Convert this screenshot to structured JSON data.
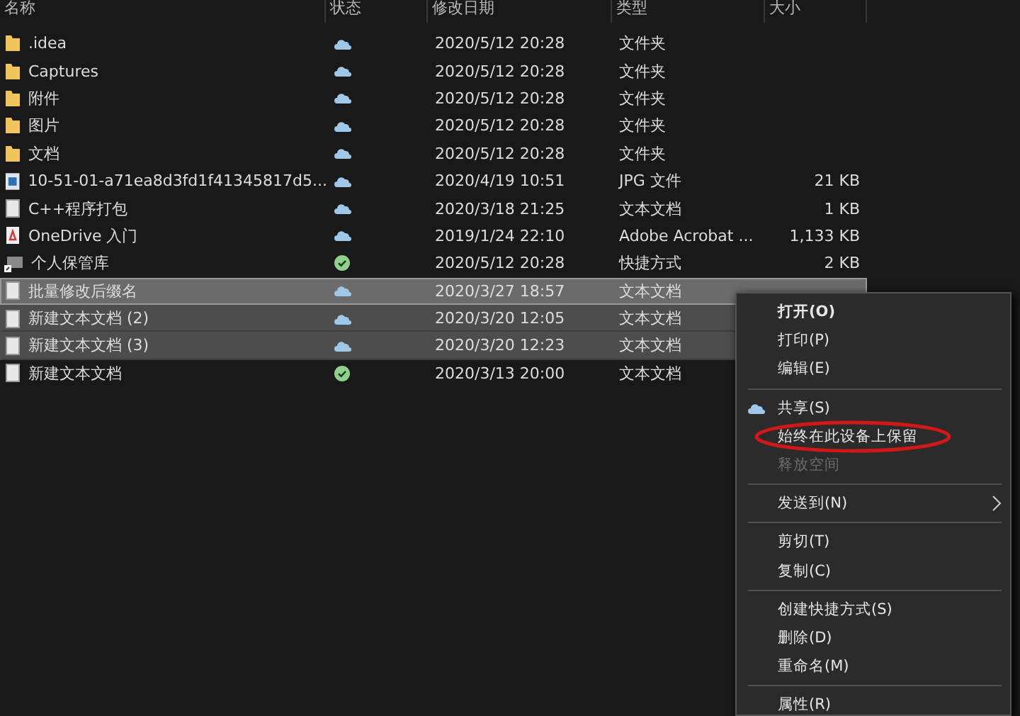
{
  "columns": [
    "名称",
    "状态",
    "修改日期",
    "类型",
    "大小"
  ],
  "rows": [
    {
      "kind": "folder",
      "name": ".idea",
      "synced": false,
      "date": "2020/5/12 20:28",
      "type": "文件夹",
      "size": "",
      "selected": false,
      "focused": false
    },
    {
      "kind": "folder",
      "name": "Captures",
      "synced": false,
      "date": "2020/5/12 20:28",
      "type": "文件夹",
      "size": "",
      "selected": false,
      "focused": false
    },
    {
      "kind": "folder",
      "name": "附件",
      "synced": false,
      "date": "2020/5/12 20:28",
      "type": "文件夹",
      "size": "",
      "selected": false,
      "focused": false
    },
    {
      "kind": "folder",
      "name": "图片",
      "synced": false,
      "date": "2020/5/12 20:28",
      "type": "文件夹",
      "size": "",
      "selected": false,
      "focused": false
    },
    {
      "kind": "folder",
      "name": "文档",
      "synced": false,
      "date": "2020/5/12 20:28",
      "type": "文件夹",
      "size": "",
      "selected": false,
      "focused": false
    },
    {
      "kind": "image",
      "name": "10-51-01-a71ea8d3fd1f41345817d5...",
      "synced": false,
      "date": "2020/4/19 10:51",
      "type": "JPG 文件",
      "size": "21 KB",
      "selected": false,
      "focused": false
    },
    {
      "kind": "text",
      "name": "C++程序打包",
      "synced": false,
      "date": "2020/3/18 21:25",
      "type": "文本文档",
      "size": "1 KB",
      "selected": false,
      "focused": false
    },
    {
      "kind": "pdf",
      "name": "OneDrive 入门",
      "synced": false,
      "date": "2019/1/24 22:10",
      "type": "Adobe Acrobat ...",
      "size": "1,133 KB",
      "selected": false,
      "focused": false
    },
    {
      "kind": "shortcut",
      "name": "个人保管库",
      "synced": true,
      "date": "2020/5/12 20:28",
      "type": "快捷方式",
      "size": "2 KB",
      "selected": false,
      "focused": false
    },
    {
      "kind": "text",
      "name": "批量修改后缀名",
      "synced": false,
      "date": "2020/3/27 18:57",
      "type": "文本文档",
      "size": "",
      "selected": true,
      "focused": true
    },
    {
      "kind": "text",
      "name": "新建文本文档 (2)",
      "synced": false,
      "date": "2020/3/20 12:05",
      "type": "文本文档",
      "size": "",
      "selected": true,
      "focused": false
    },
    {
      "kind": "text",
      "name": "新建文本文档 (3)",
      "synced": false,
      "date": "2020/3/20 12:23",
      "type": "文本文档",
      "size": "",
      "selected": true,
      "focused": false
    },
    {
      "kind": "text",
      "name": "新建文本文档",
      "synced": true,
      "date": "2020/3/13 20:00",
      "type": "文本文档",
      "size": "",
      "selected": false,
      "focused": false
    }
  ],
  "context_menu": [
    {
      "kind": "item",
      "label": "打开(O)",
      "bold": true,
      "disabled": false,
      "circled": false
    },
    {
      "kind": "item",
      "label": "打印(P)",
      "bold": false,
      "disabled": false,
      "circled": false
    },
    {
      "kind": "item",
      "label": "编辑(E)",
      "bold": false,
      "disabled": false,
      "circled": false
    },
    {
      "kind": "separator"
    },
    {
      "kind": "shared",
      "label": "共享(S)",
      "bold": false,
      "disabled": false,
      "circled": false
    },
    {
      "kind": "item",
      "label": "始终在此设备上保留",
      "bold": false,
      "disabled": false,
      "circled": true
    },
    {
      "kind": "item",
      "label": "释放空间",
      "bold": false,
      "disabled": true,
      "circled": false
    },
    {
      "kind": "separator"
    },
    {
      "kind": "submenu",
      "label": "发送到(N)",
      "bold": false,
      "disabled": false,
      "circled": false
    },
    {
      "kind": "separator"
    },
    {
      "kind": "item",
      "label": "剪切(T)",
      "bold": false,
      "disabled": false,
      "circled": false
    },
    {
      "kind": "item",
      "label": "复制(C)",
      "bold": false,
      "disabled": false,
      "circled": false
    },
    {
      "kind": "separator"
    },
    {
      "kind": "item",
      "label": "创建快捷方式(S)",
      "bold": false,
      "disabled": false,
      "circled": false
    },
    {
      "kind": "item",
      "label": "删除(D)",
      "bold": false,
      "disabled": false,
      "circled": false
    },
    {
      "kind": "item",
      "label": "重命名(M)",
      "bold": false,
      "disabled": false,
      "circled": false
    },
    {
      "kind": "separator"
    },
    {
      "kind": "item",
      "label": "属性(R)",
      "bold": false,
      "disabled": false,
      "circled": false
    }
  ]
}
